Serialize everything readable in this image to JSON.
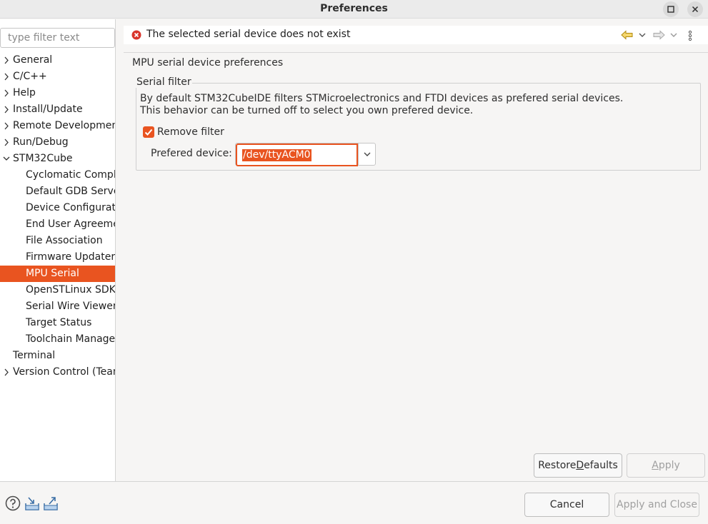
{
  "window": {
    "title": "Preferences"
  },
  "filter": {
    "placeholder": "type filter text"
  },
  "tree": [
    {
      "label": "General",
      "level": 0,
      "expandable": true
    },
    {
      "label": "C/C++",
      "level": 0,
      "expandable": true
    },
    {
      "label": "Help",
      "level": 0,
      "expandable": true
    },
    {
      "label": "Install/Update",
      "level": 0,
      "expandable": true
    },
    {
      "label": "Remote Development",
      "level": 0,
      "expandable": true
    },
    {
      "label": "Run/Debug",
      "level": 0,
      "expandable": true
    },
    {
      "label": "STM32Cube",
      "level": 0,
      "expandable": true,
      "expanded": true
    },
    {
      "label": "Cyclomatic Complexity",
      "level": 1
    },
    {
      "label": "Default GDB Server",
      "level": 1
    },
    {
      "label": "Device Configuration Tool",
      "level": 1
    },
    {
      "label": "End User Agreement",
      "level": 1
    },
    {
      "label": "File Association",
      "level": 1
    },
    {
      "label": "Firmware Updater",
      "level": 1
    },
    {
      "label": "MPU Serial",
      "level": 1,
      "selected": true
    },
    {
      "label": "OpenSTLinux SDK Manager",
      "level": 1
    },
    {
      "label": "Serial Wire Viewer",
      "level": 1
    },
    {
      "label": "Target Status",
      "level": 1
    },
    {
      "label": "Toolchain Manager",
      "level": 1
    },
    {
      "label": "Terminal",
      "level": 0
    },
    {
      "label": "Version Control (Team)",
      "level": 0,
      "expandable": true
    }
  ],
  "header": {
    "error_message": "The selected serial device does not exist"
  },
  "page": {
    "title": "MPU serial device preferences",
    "group_label": "Serial filter",
    "description_line1": "By default STM32CubeIDE filters STMicroelectronics and FTDI devices as prefered serial devices.",
    "description_line2": "This behavior can be turned off to select you own prefered device.",
    "remove_filter_label": "Remove filter",
    "remove_filter_checked": true,
    "prefered_device_label": "Prefered device:",
    "prefered_device_value": "/dev/ttyACM0"
  },
  "buttons": {
    "restore_defaults_pre": "Restore ",
    "restore_defaults_mnemonic": "D",
    "restore_defaults_post": "efaults",
    "apply_mnemonic": "A",
    "apply_post": "pply",
    "cancel": "Cancel",
    "apply_and_close": "Apply and Close"
  },
  "colors": {
    "accent": "#e95420",
    "error": "#d9352b"
  },
  "icons": {
    "help": "help-icon",
    "import": "import-icon",
    "export": "export-icon",
    "back": "back-arrow-icon",
    "forward": "forward-arrow-icon",
    "menu": "view-menu-icon"
  }
}
